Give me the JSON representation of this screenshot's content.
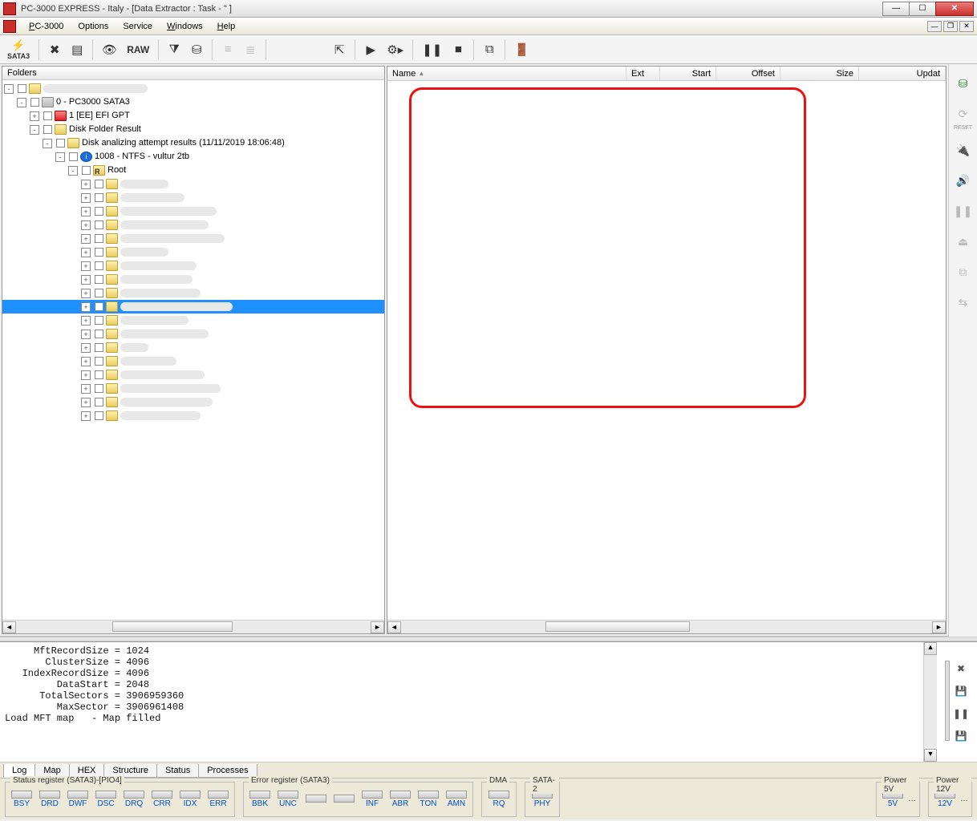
{
  "title": "PC-3000 EXPRESS - Italy - [Data Extractor : Task - \"                               ]",
  "menu": {
    "pc3000": "PC-3000",
    "options": "Options",
    "service": "Service",
    "windows": "Windows",
    "help": "Help"
  },
  "toolbar": {
    "sata": "SATA3",
    "raw": "RAW"
  },
  "folders": {
    "header": "Folders",
    "root": "",
    "drive": "0 - PC3000 SATA3",
    "efi": "1 [EE] EFI GPT",
    "dfr": "Disk Folder Result",
    "attempt": "Disk analizing attempt results (11/11/2019 18:06:48)",
    "ntfs": "1008 - NTFS - vultur 2tb",
    "rootfolder": "Root"
  },
  "listcols": {
    "name": "Name",
    "ext": "Ext",
    "start": "Start",
    "offset": "Offset",
    "size": "Size",
    "updat": "Updat"
  },
  "log": {
    "l1": "     MftRecordSize = 1024",
    "l2": "       ClusterSize = 4096",
    "l3": "   IndexRecordSize = 4096",
    "l4": "         DataStart = 2048",
    "l5": "      TotalSectors = 3906959360",
    "l6": "         MaxSector = 3906961408",
    "l7": "Load MFT map   - Map filled"
  },
  "logtabs": {
    "log": "Log",
    "map": "Map",
    "hex": "HEX",
    "structure": "Structure",
    "status": "Status",
    "processes": "Processes"
  },
  "status": {
    "sreg": "Status register (SATA3)-[PIO4]",
    "ereg": "Error register (SATA3)",
    "dma": "DMA",
    "sata2": "SATA-2",
    "p5": "Power 5V",
    "p12": "Power 12V",
    "bits_s": [
      "BSY",
      "DRD",
      "DWF",
      "DSC",
      "DRQ",
      "CRR",
      "IDX",
      "ERR"
    ],
    "bits_e": [
      "BBK",
      "UNC",
      "",
      "",
      "INF",
      "ABR",
      "TON",
      "AMN"
    ],
    "rq": "RQ",
    "phy": "PHY",
    "v5": "5V",
    "v12": "12V"
  },
  "side": {
    "reset": "RESET"
  }
}
